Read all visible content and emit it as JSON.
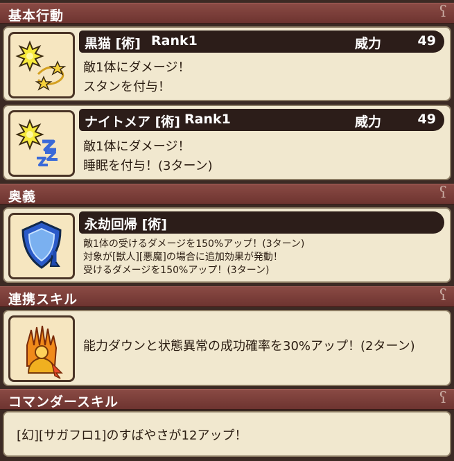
{
  "sections": {
    "basic": "基本行動",
    "ougi": "奥義",
    "renkei": "連携スキル",
    "commander": "コマンダースキル"
  },
  "skills": [
    {
      "name": "黒猫 [術]",
      "rank": "Rank1",
      "power_label": "威力",
      "power": "49",
      "desc": [
        "敵1体にダメージ！",
        "スタンを付与！"
      ],
      "icon": "stun-star-icon"
    },
    {
      "name": "ナイトメア [術]",
      "rank": "Rank1",
      "power_label": "威力",
      "power": "49",
      "desc": [
        "敵1体にダメージ！",
        "睡眠を付与！(3ターン)"
      ],
      "icon": "sleep-icon"
    }
  ],
  "ougi": {
    "name": "永劫回帰 [術]",
    "desc": [
      "敵1体の受けるダメージを150%アップ！(3ターン)",
      "対象が[獣人][悪魔]の場合に追加効果が発動！",
      "受けるダメージを150%アップ！(3ターン)"
    ],
    "icon": "shield-down-icon"
  },
  "renkei": {
    "desc": "能力ダウンと状態異常の成功確率を30%アップ！(2ターン)",
    "icon": "hand-up-icon"
  },
  "commander": {
    "desc": "[幻][サガフロ1]のすばやさが12アップ！"
  }
}
